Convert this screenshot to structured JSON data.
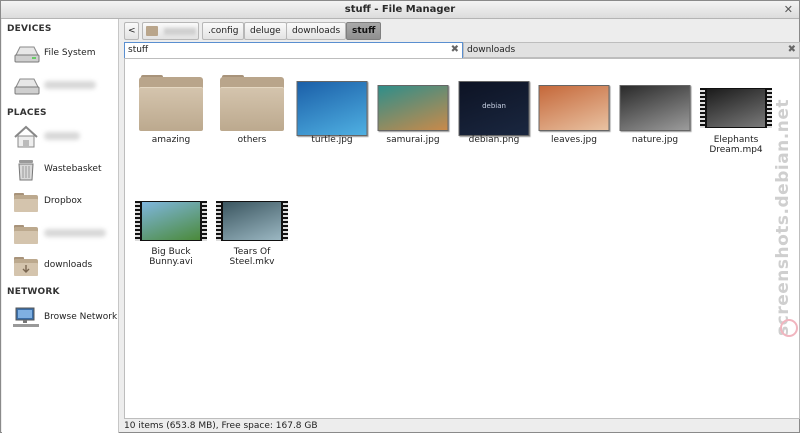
{
  "window": {
    "title": "stuff - File Manager",
    "close_label": "✕"
  },
  "sidebar": {
    "sections": {
      "devices": "DEVICES",
      "places": "PLACES",
      "network": "NETWORK"
    },
    "items": [
      {
        "label": "File System",
        "icon": "drive-icon"
      },
      {
        "label": "",
        "icon": "drive-icon"
      },
      {
        "label": "",
        "icon": "home-icon"
      },
      {
        "label": "Wastebasket",
        "icon": "trash-icon"
      },
      {
        "label": "Dropbox",
        "icon": "folder-icon"
      },
      {
        "label": "",
        "icon": "folder-icon"
      },
      {
        "label": "downloads",
        "icon": "downloads-folder-icon"
      },
      {
        "label": "Browse Network",
        "icon": "network-icon"
      }
    ]
  },
  "pathbar": {
    "back_label": "<",
    "crumbs": [
      ".config",
      "deluge",
      "downloads",
      "stuff"
    ]
  },
  "tabs": [
    {
      "label": "stuff",
      "close": "✖"
    },
    {
      "label": "downloads",
      "close": "✖"
    }
  ],
  "files": [
    {
      "name": "amazing",
      "kind": "folder"
    },
    {
      "name": "others",
      "kind": "folder"
    },
    {
      "name": "turtle.jpg",
      "kind": "image",
      "palette": [
        "#1b5fa8",
        "#4fb0e2"
      ]
    },
    {
      "name": "samurai.jpg",
      "kind": "image",
      "palette": [
        "#2f8e8a",
        "#c98a4a"
      ]
    },
    {
      "name": "debian.png",
      "kind": "image",
      "palette": [
        "#0d1324",
        "#1a2740"
      ],
      "text": "debian"
    },
    {
      "name": "leaves.jpg",
      "kind": "image",
      "palette": [
        "#c5683a",
        "#e9c2a2"
      ]
    },
    {
      "name": "nature.jpg",
      "kind": "image",
      "palette": [
        "#2a2a2a",
        "#9c9c9c"
      ]
    },
    {
      "name": "Elephants Dream.mp4",
      "kind": "video",
      "palette": [
        "#1b1b1b",
        "#7a7a7a"
      ]
    },
    {
      "name": "Big Buck Bunny.avi",
      "kind": "video",
      "palette": [
        "#7fb6de",
        "#4b8a3a"
      ]
    },
    {
      "name": "Tears Of Steel.mkv",
      "kind": "video",
      "palette": [
        "#3b5660",
        "#9bb7c2"
      ]
    }
  ],
  "status": "10 items (653.8 MB), Free space: 167.8 GB",
  "watermark": "screenshots.debian.net"
}
